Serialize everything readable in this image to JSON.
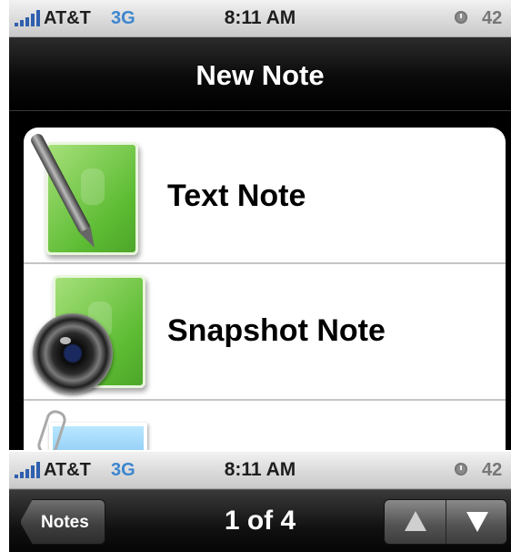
{
  "status_bar": {
    "carrier": "AT&T",
    "network": "3G",
    "time": "8:11 AM",
    "battery": "42",
    "signal_icon": "signal-bars-icon",
    "clock_icon": "alarm-clock-icon"
  },
  "title_bar": {
    "title": "New Note"
  },
  "note_types": [
    {
      "label": "Text Note",
      "icon": "text-note-icon"
    },
    {
      "label": "Snapshot Note",
      "icon": "snapshot-note-icon"
    },
    {
      "label": "",
      "icon": "file-note-icon"
    }
  ],
  "status_bar_2": {
    "carrier": "AT&T",
    "network": "3G",
    "time": "8:11 AM",
    "battery": "42"
  },
  "nav_bar": {
    "back_label": "Notes",
    "title": "1 of 4",
    "prev_icon": "up-arrow-icon",
    "next_icon": "down-arrow-icon"
  },
  "colors": {
    "status_blue": "#3d86cf",
    "note_green": "#5cbb32",
    "bar_black": "#000000"
  }
}
